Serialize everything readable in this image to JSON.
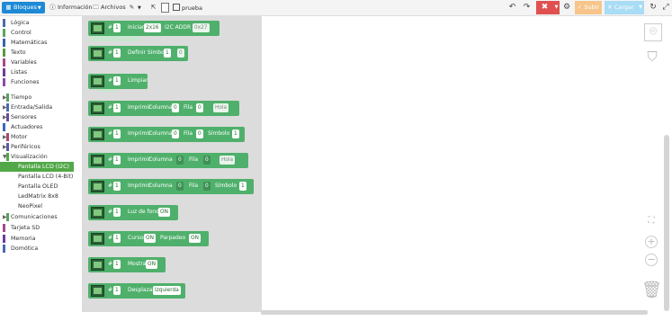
{
  "toolbar": {
    "tab_blocks": "Bloques",
    "tab_info": "Información",
    "tab_files": "Archivos",
    "project_name": "prueba",
    "undo_icon": "undo-icon",
    "redo_icon": "redo-icon",
    "settings_icon": "gear-icon",
    "verify_label": "Subir",
    "upload_label": "Cargar",
    "colors": {
      "active_tab": "#1e8ad6",
      "red": "#e05050",
      "orange": "#f7c58b",
      "blue": "#a9dcf5"
    }
  },
  "categories": [
    {
      "label": "Lógica",
      "color": "#4a6ab0"
    },
    {
      "label": "Control",
      "color": "#56a85a"
    },
    {
      "label": "Matemáticas",
      "color": "#3b5fb0"
    },
    {
      "label": "Texto",
      "color": "#5b9b3a"
    },
    {
      "label": "Variables",
      "color": "#a8488a"
    },
    {
      "label": "Listas",
      "color": "#6a3b9c"
    },
    {
      "label": "Funciones",
      "color": "#8a4aa8"
    },
    {
      "label": "Tiempo",
      "color": "#5aa05a",
      "arrow": true
    },
    {
      "label": "Entrada/Salida",
      "color": "#4a6ab0",
      "arrow": true
    },
    {
      "label": "Sensores",
      "color": "#6a4aa0",
      "arrow": true
    },
    {
      "label": "Actuadores",
      "color": "#3b6ab0"
    },
    {
      "label": "Motor",
      "color": "#a84a6a",
      "arrow": true
    },
    {
      "label": "Periféricos",
      "color": "#5a5ab0",
      "arrow": true
    },
    {
      "label": "Visualización",
      "color": "#52a848",
      "arrow": true,
      "open": true
    },
    {
      "label": "Pantalla LCD (I2C)",
      "sub": true,
      "selected": true
    },
    {
      "label": "Pantalla LCD (4-Bit)",
      "sub": true
    },
    {
      "label": "Pantalla OLED",
      "sub": true
    },
    {
      "label": "LedMatrix 8x8",
      "sub": true
    },
    {
      "label": "NeoPixel",
      "sub": true
    },
    {
      "label": "Comunicaciones",
      "color": "#5aa05a",
      "arrow": true
    },
    {
      "label": "Tarjeta SD",
      "color": "#a8488a"
    },
    {
      "label": "Memoria",
      "color": "#6a3b9c"
    },
    {
      "label": "Domótica",
      "color": "#4a6ab0"
    }
  ],
  "blocks": [
    {
      "slots": [
        "#",
        "1",
        "Iniciar",
        "2x16",
        "I2C ADDR",
        "0x27"
      ]
    },
    {
      "slots": [
        "#",
        "1",
        "Definir Símbolo",
        "1",
        "0"
      ]
    },
    {
      "slots": [
        "#",
        "1",
        "Limpiar"
      ]
    },
    {
      "slots": [
        "#",
        "1",
        "Imprimir",
        "Columna",
        "0",
        "Fila",
        "0",
        "Hola"
      ]
    },
    {
      "slots": [
        "#",
        "1",
        "Imprimir",
        "Columna",
        "0",
        "Fila",
        "0",
        "Símbolo",
        "1"
      ]
    },
    {
      "slots": [
        "#",
        "1",
        "Imprimir",
        "Columna",
        "0",
        "Fila",
        "0",
        "Hola"
      ]
    },
    {
      "slots": [
        "#",
        "1",
        "Imprimir",
        "Columna",
        "0",
        "Fila",
        "0",
        "Símbolo",
        "1"
      ]
    },
    {
      "slots": [
        "#",
        "1",
        "Luz de fondo",
        "ON"
      ]
    },
    {
      "slots": [
        "#",
        "1",
        "Cursor",
        "ON",
        "Parpadeo",
        "ON"
      ]
    },
    {
      "slots": [
        "#",
        "1",
        "Mostrar",
        "ON"
      ]
    },
    {
      "slots": [
        "#",
        "1",
        "Desplazar",
        "Izquierda"
      ]
    }
  ]
}
